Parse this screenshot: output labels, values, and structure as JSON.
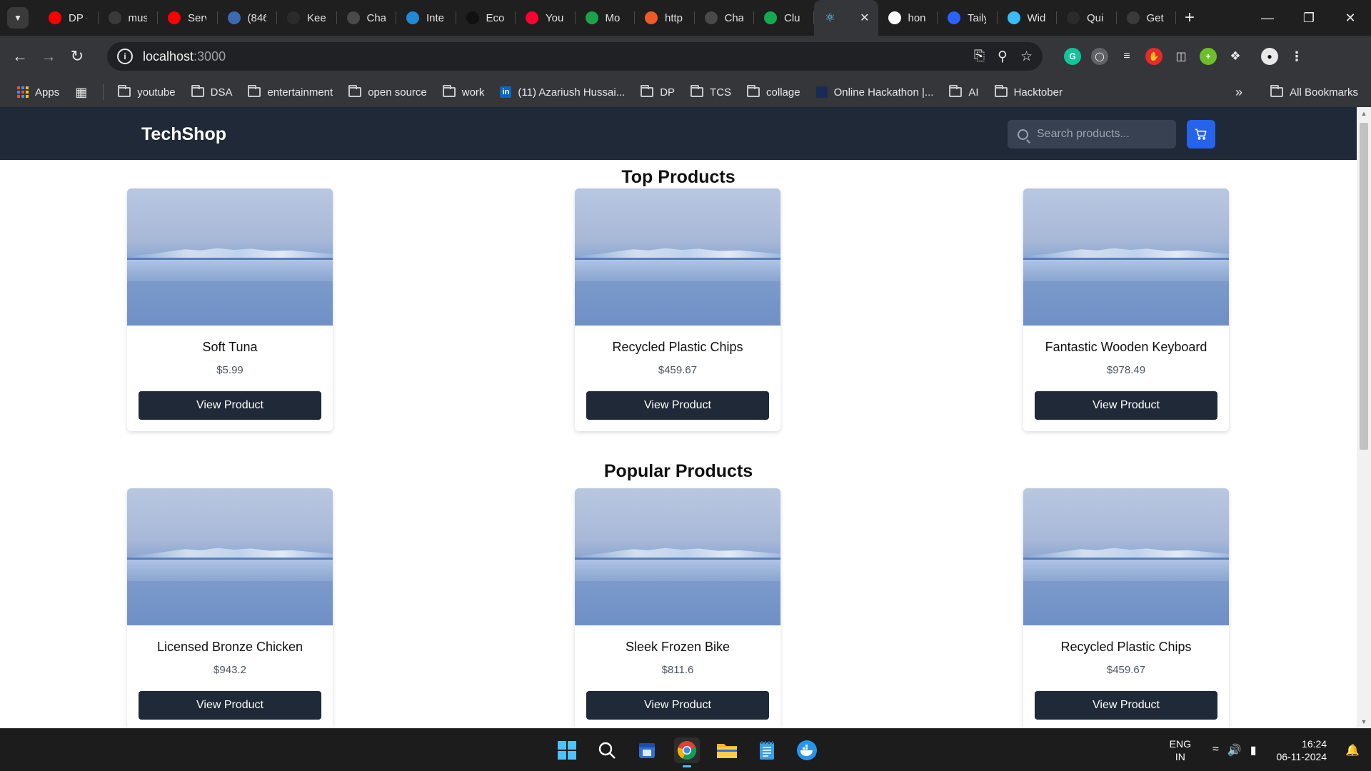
{
  "browser": {
    "tabs": [
      {
        "label": "DP -",
        "icon": "youtube-icon",
        "color": "#ff0000"
      },
      {
        "label": "mus",
        "icon": "play-icon",
        "color": "#3a3a3a"
      },
      {
        "label": "Serv",
        "icon": "youtube-icon",
        "color": "#ff0000"
      },
      {
        "label": "(846",
        "icon": "8k-icon",
        "color": "#3b6ab3"
      },
      {
        "label": "Kee",
        "icon": "github-icon",
        "color": "#2b2b2b"
      },
      {
        "label": "Cha",
        "icon": "chatgpt-icon",
        "color": "#4a4a4a"
      },
      {
        "label": "Inte",
        "icon": "is-icon",
        "color": "#1f8ad6"
      },
      {
        "label": "Eco",
        "icon": "ecosia-icon",
        "color": "#111111"
      },
      {
        "label": "You",
        "icon": "youtube-music-icon",
        "color": "#ff0033"
      },
      {
        "label": "Mo",
        "icon": "leaf-icon",
        "color": "#1aa34a"
      },
      {
        "label": "http",
        "icon": "postman-icon",
        "color": "#ef5b25"
      },
      {
        "label": "Cha",
        "icon": "chatgpt-icon",
        "color": "#4a4a4a"
      },
      {
        "label": "Clu",
        "icon": "mongodb-icon",
        "color": "#13aa52"
      },
      {
        "label": "",
        "icon": "react-icon",
        "color": "#61dafb"
      },
      {
        "label": "hon",
        "icon": "google-icon",
        "color": "#ffffff"
      },
      {
        "label": "Taily",
        "icon": "p-icon",
        "color": "#2962ff"
      },
      {
        "label": "Wid",
        "icon": "tailwind-icon",
        "color": "#38bdf8"
      },
      {
        "label": "Qui",
        "icon": "github-icon",
        "color": "#2b2b2b"
      },
      {
        "label": "Get",
        "icon": "a-icon",
        "color": "#3a3a3a"
      }
    ],
    "url_host": "localhost",
    "url_port": ":3000",
    "bookmarks": [
      {
        "label": "youtube"
      },
      {
        "label": "DSA"
      },
      {
        "label": "entertainment"
      },
      {
        "label": "open source"
      },
      {
        "label": "work"
      },
      {
        "label": "(11) Azariush Hussai..."
      },
      {
        "label": "DP"
      },
      {
        "label": "TCS"
      },
      {
        "label": "collage"
      },
      {
        "label": "Online Hackathon |..."
      },
      {
        "label": "AI"
      },
      {
        "label": "Hacktober"
      }
    ],
    "apps_label": "Apps",
    "all_bookmarks_label": "All Bookmarks"
  },
  "site": {
    "brand": "TechShop",
    "search_placeholder": "Search products...",
    "sections": [
      {
        "title": "Top Products",
        "products": [
          {
            "name": "Soft Tuna",
            "price": "$5.99",
            "button": "View Product"
          },
          {
            "name": "Recycled Plastic Chips",
            "price": "$459.67",
            "button": "View Product"
          },
          {
            "name": "Fantastic Wooden Keyboard",
            "price": "$978.49",
            "button": "View Product"
          }
        ]
      },
      {
        "title": "Popular Products",
        "products": [
          {
            "name": "Licensed Bronze Chicken",
            "price": "$943.2",
            "button": "View Product"
          },
          {
            "name": "Sleek Frozen Bike",
            "price": "$811.6",
            "button": "View Product"
          },
          {
            "name": "Recycled Plastic Chips",
            "price": "$459.67",
            "button": "View Product"
          }
        ]
      }
    ]
  },
  "taskbar": {
    "lang_line1": "ENG",
    "lang_line2": "IN",
    "time": "16:24",
    "date": "06-11-2024"
  }
}
